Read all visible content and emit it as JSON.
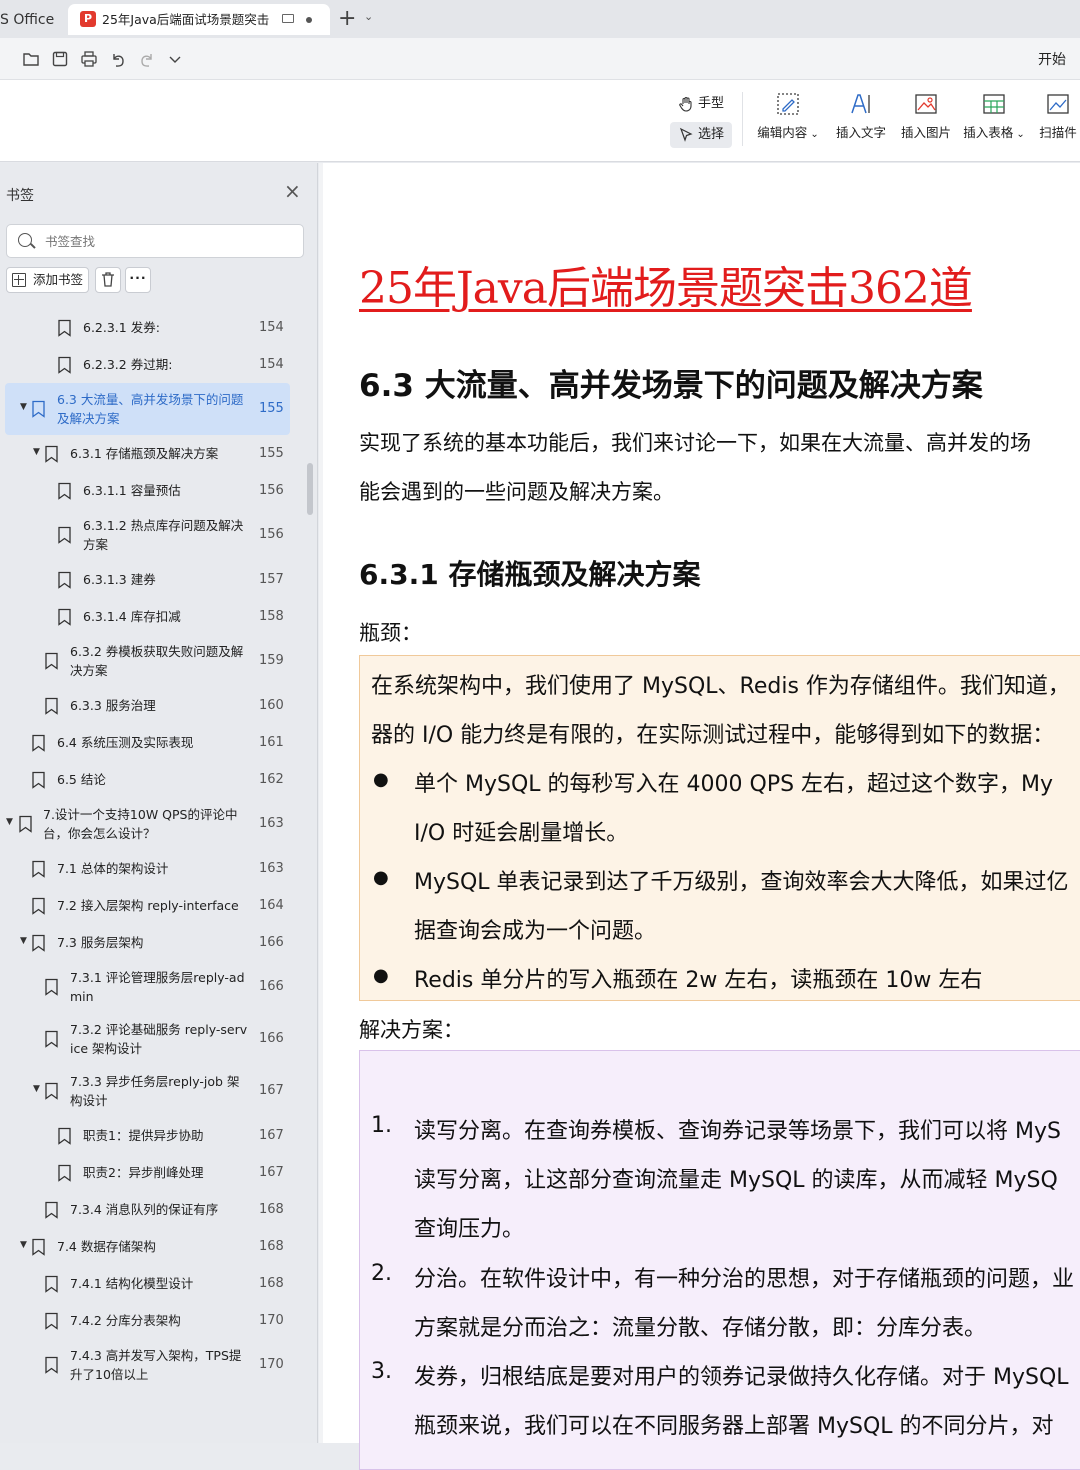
{
  "tabs": {
    "app_label": "S Office",
    "doc_title": "25年Java后端面试场景题突击"
  },
  "quickbar": {
    "start_label": "开始"
  },
  "ribbon": {
    "hand_label": "手型",
    "select_label": "选择",
    "tools": [
      {
        "label": "编辑内容",
        "icon": "edit-content-icon",
        "dropdown": true
      },
      {
        "label": "插入文字",
        "icon": "insert-text-icon",
        "dropdown": false
      },
      {
        "label": "插入图片",
        "icon": "insert-image-icon",
        "dropdown": false
      },
      {
        "label": "插入表格",
        "icon": "insert-table-icon",
        "dropdown": true
      },
      {
        "label": "扫描件",
        "icon": "scan-icon",
        "dropdown": false
      }
    ]
  },
  "sidebar": {
    "title": "书签",
    "search_placeholder": "书签查找",
    "add_label": "添加书签",
    "more_label": "···",
    "bookmarks": [
      {
        "lines": [
          "6.2.3.1 发券:"
        ],
        "page": "154",
        "level": 3,
        "expanded": null,
        "selected": false
      },
      {
        "lines": [
          "6.2.3.2 券过期:"
        ],
        "page": "154",
        "level": 3,
        "expanded": null,
        "selected": false
      },
      {
        "lines": [
          "6.3 大流量、高并发场景下的问题",
          "及解决方案"
        ],
        "page": "155",
        "level": 1,
        "expanded": true,
        "selected": true
      },
      {
        "lines": [
          "6.3.1 存储瓶颈及解决方案"
        ],
        "page": "155",
        "level": 2,
        "expanded": true,
        "selected": false
      },
      {
        "lines": [
          "6.3.1.1 容量预估"
        ],
        "page": "156",
        "level": 3,
        "expanded": null,
        "selected": false
      },
      {
        "lines": [
          "6.3.1.2 热点库存问题及解决",
          "方案"
        ],
        "page": "156",
        "level": 3,
        "expanded": null,
        "selected": false
      },
      {
        "lines": [
          "6.3.1.3 建券"
        ],
        "page": "157",
        "level": 3,
        "expanded": null,
        "selected": false
      },
      {
        "lines": [
          "6.3.1.4 库存扣减"
        ],
        "page": "158",
        "level": 3,
        "expanded": null,
        "selected": false
      },
      {
        "lines": [
          "6.3.2 券模板获取失败问题及解",
          "决方案"
        ],
        "page": "159",
        "level": 2,
        "expanded": null,
        "selected": false
      },
      {
        "lines": [
          "6.3.3 服务治理"
        ],
        "page": "160",
        "level": 2,
        "expanded": null,
        "selected": false
      },
      {
        "lines": [
          "6.4 系统压测及实际表现"
        ],
        "page": "161",
        "level": 1,
        "expanded": null,
        "selected": false
      },
      {
        "lines": [
          "6.5 结论"
        ],
        "page": "162",
        "level": 1,
        "expanded": null,
        "selected": false
      },
      {
        "lines": [
          "7.设计一个支持10W QPS的评论中",
          "台，你会怎么设计？"
        ],
        "page": "163",
        "level": 0,
        "expanded": true,
        "selected": false
      },
      {
        "lines": [
          "7.1 总体的架构设计"
        ],
        "page": "163",
        "level": 1,
        "expanded": null,
        "selected": false
      },
      {
        "lines": [
          "7.2 接入层架构 reply-interface"
        ],
        "page": "164",
        "level": 1,
        "expanded": null,
        "selected": false
      },
      {
        "lines": [
          "7.3 服务层架构"
        ],
        "page": "166",
        "level": 1,
        "expanded": true,
        "selected": false
      },
      {
        "lines": [
          "7.3.1 评论管理服务层reply-ad",
          "min"
        ],
        "page": "166",
        "level": 2,
        "expanded": null,
        "selected": false
      },
      {
        "lines": [
          "7.3.2 评论基础服务 reply-serv",
          "ice 架构设计"
        ],
        "page": "166",
        "level": 2,
        "expanded": null,
        "selected": false
      },
      {
        "lines": [
          "7.3.3 异步任务层reply-job 架",
          "构设计"
        ],
        "page": "167",
        "level": 2,
        "expanded": true,
        "selected": false
      },
      {
        "lines": [
          "职责1：提供异步协助"
        ],
        "page": "167",
        "level": 3,
        "expanded": null,
        "selected": false
      },
      {
        "lines": [
          "职责2：异步削峰处理"
        ],
        "page": "167",
        "level": 3,
        "expanded": null,
        "selected": false
      },
      {
        "lines": [
          "7.3.4 消息队列的保证有序"
        ],
        "page": "168",
        "level": 2,
        "expanded": null,
        "selected": false
      },
      {
        "lines": [
          "7.4 数据存储架构"
        ],
        "page": "168",
        "level": 1,
        "expanded": true,
        "selected": false
      },
      {
        "lines": [
          "7.4.1 结构化模型设计"
        ],
        "page": "168",
        "level": 2,
        "expanded": null,
        "selected": false
      },
      {
        "lines": [
          "7.4.2 分库分表架构"
        ],
        "page": "170",
        "level": 2,
        "expanded": null,
        "selected": false
      },
      {
        "lines": [
          "7.4.3 高并发写入架构，TPS提",
          "升了10倍以上"
        ],
        "page": "170",
        "level": 2,
        "expanded": null,
        "selected": false
      }
    ]
  },
  "document": {
    "title": "25年Java后端场景题突击362道",
    "section_63": "6.3  大流量、高并发场景下的问题及解决方案",
    "intro_line1": "实现了系统的基本功能后，我们来讨论一下，如果在大流量、高并发的场",
    "intro_line2": "能会遇到的一些问题及解决方案。",
    "section_631": "6.3.1  存储瓶颈及解决方案",
    "bottleneck_label": "瓶颈：",
    "box1": {
      "line1": "在系统架构中，我们使用了 MySQL、Redis 作为存储组件。我们知道，",
      "line2": "器的 I/O 能力终是有限的，在实际测试过程中，能够得到如下的数据：",
      "bullet1_line1": "单个 MySQL 的每秒写入在 4000 QPS 左右，超过这个数字，My",
      "bullet1_line2": "I/O 时延会剧量增长。",
      "bullet2_line1": "MySQL 单表记录到达了千万级别，查询效率会大大降低，如果过亿",
      "bullet2_line2": "据查询会成为一个问题。",
      "bullet3_line1": "Redis 单分片的写入瓶颈在 2w 左右，读瓶颈在 10w 左右"
    },
    "solution_label": "解决方案：",
    "box2": {
      "n1": "1.",
      "item1_line1": "读写分离。在查询券模板、查询券记录等场景下，我们可以将 MyS",
      "item1_line2": "读写分离，让这部分查询流量走 MySQL 的读库，从而减轻 MySQ",
      "item1_line3": "查询压力。",
      "n2": "2.",
      "item2_line1": "分治。在软件设计中，有一种分治的思想，对于存储瓶颈的问题，业",
      "item2_line2": "方案就是分而治之：流量分散、存储分散，即：分库分表。",
      "n3": "3.",
      "item3_line1": "发券，归根结底是要对用户的领券记录做持久化存储。对于 MySQL",
      "item3_line2": "瓶颈来说，我们可以在不同服务器上部署 MySQL 的不同分片，对"
    }
  },
  "colors": {
    "title_red": "#e21c1c",
    "selected_bg": "#cfe0f8",
    "selected_text": "#2e6bc7",
    "box1_bg": "#fdf3e6",
    "box2_bg": "#f6eefb"
  }
}
